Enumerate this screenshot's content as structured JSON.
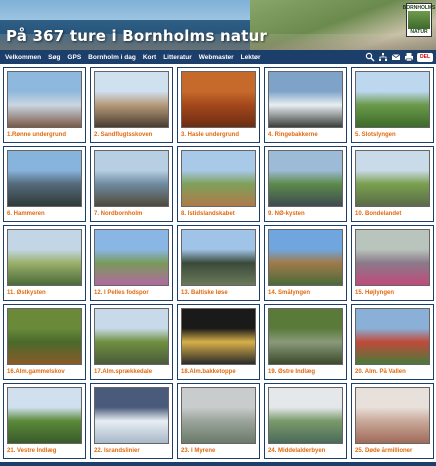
{
  "header": {
    "title": "På 367 ture i Bornholms natur",
    "logo_text": [
      "BORNHOLMS",
      "NATUR"
    ]
  },
  "nav": {
    "items": [
      "Velkommen",
      "Søg",
      "GPS",
      "Bornholm i dag",
      "Kort",
      "Litteratur",
      "Webmaster",
      "Lektør"
    ],
    "icons": [
      "search-icon",
      "sitemap-icon",
      "mail-icon",
      "print-icon"
    ],
    "lang_label": "DEL"
  },
  "tours": [
    {
      "label": "1.Rønne undergrund",
      "colors": [
        "#8fb8de",
        "#c9d6e0",
        "#7a5a46"
      ]
    },
    {
      "label": "2. Sandflugtsskoven",
      "colors": [
        "#cfe0ef",
        "#b59a7a",
        "#4a3c2e"
      ]
    },
    {
      "label": "3. Hasle undergrund",
      "colors": [
        "#c56a2a",
        "#a4471c",
        "#6b2e12"
      ]
    },
    {
      "label": "4. Ringebakkerne",
      "colors": [
        "#7fa3c8",
        "#e8eef2",
        "#3a3f3a"
      ]
    },
    {
      "label": "5. Slotslyngen",
      "colors": [
        "#bcd7ee",
        "#6a9a4a",
        "#3d6a2a"
      ]
    },
    {
      "label": "6. Hammeren",
      "colors": [
        "#86b4dc",
        "#556a7a",
        "#2f3a38"
      ]
    },
    {
      "label": "7. Nordbornholm",
      "colors": [
        "#b8cfe3",
        "#6f8aa0",
        "#4f4a3a"
      ]
    },
    {
      "label": "8. Istidslandskabet",
      "colors": [
        "#a9c9e8",
        "#7ea05a",
        "#b07a4a"
      ]
    },
    {
      "label": "9. NØ-kysten",
      "colors": [
        "#9dbbd6",
        "#5d8a4a",
        "#3f4a52"
      ]
    },
    {
      "label": "10. Bondelandet",
      "colors": [
        "#c9dbe9",
        "#7aa04e",
        "#5a6a4a"
      ]
    },
    {
      "label": "11. Østkysten",
      "colors": [
        "#c3d6e6",
        "#9ab06a",
        "#4a6a3a"
      ]
    },
    {
      "label": "12. I Pelles fodspor",
      "colors": [
        "#8ab6e6",
        "#7a9a5a",
        "#b06aa0"
      ]
    },
    {
      "label": "13. Baltiske løse",
      "colors": [
        "#a0c4e8",
        "#3a4a3a",
        "#6a7a5a"
      ]
    },
    {
      "label": "14. Smålyngen",
      "colors": [
        "#6fa6e0",
        "#a07a4a",
        "#4a6a3a"
      ]
    },
    {
      "label": "15. Højlyngen",
      "colors": [
        "#b9c4bc",
        "#8a7a8a",
        "#c04a7a"
      ]
    },
    {
      "label": "16.Alm.gammelskov",
      "colors": [
        "#6a8a3a",
        "#4a6a2a",
        "#8a5a2a"
      ]
    },
    {
      "label": "17.Alm.sprækkedale",
      "colors": [
        "#c8dae9",
        "#6f8f3f",
        "#4a5a3a"
      ]
    },
    {
      "label": "18.Alm.bakketoppe",
      "colors": [
        "#1a1a1a",
        "#d8b04a",
        "#2a2a2a"
      ]
    },
    {
      "label": "19. Østre Indlæg",
      "colors": [
        "#5a7a3a",
        "#8a9a7a",
        "#3a4a2a"
      ]
    },
    {
      "label": "20. Alm. På Vallen",
      "colors": [
        "#8ab0d8",
        "#c04a3a",
        "#4a7a3a"
      ]
    },
    {
      "label": "21. Vestre Indlæg",
      "colors": [
        "#d0e0ee",
        "#5a8a3a",
        "#3a5a2a"
      ]
    },
    {
      "label": "22. Israndslinier",
      "colors": [
        "#4a5a7a",
        "#e8eef4",
        "#a8b8c8"
      ]
    },
    {
      "label": "23. I Myrene",
      "colors": [
        "#c8cccc",
        "#9aa49a",
        "#6a7a6a"
      ]
    },
    {
      "label": "24. Middelalderbyen",
      "colors": [
        "#e4e8ea",
        "#7a9a6a",
        "#4a6a5a"
      ]
    },
    {
      "label": "25. Døde årmillioner",
      "colors": [
        "#e8e0da",
        "#c9a99a",
        "#a06a5a"
      ]
    }
  ]
}
